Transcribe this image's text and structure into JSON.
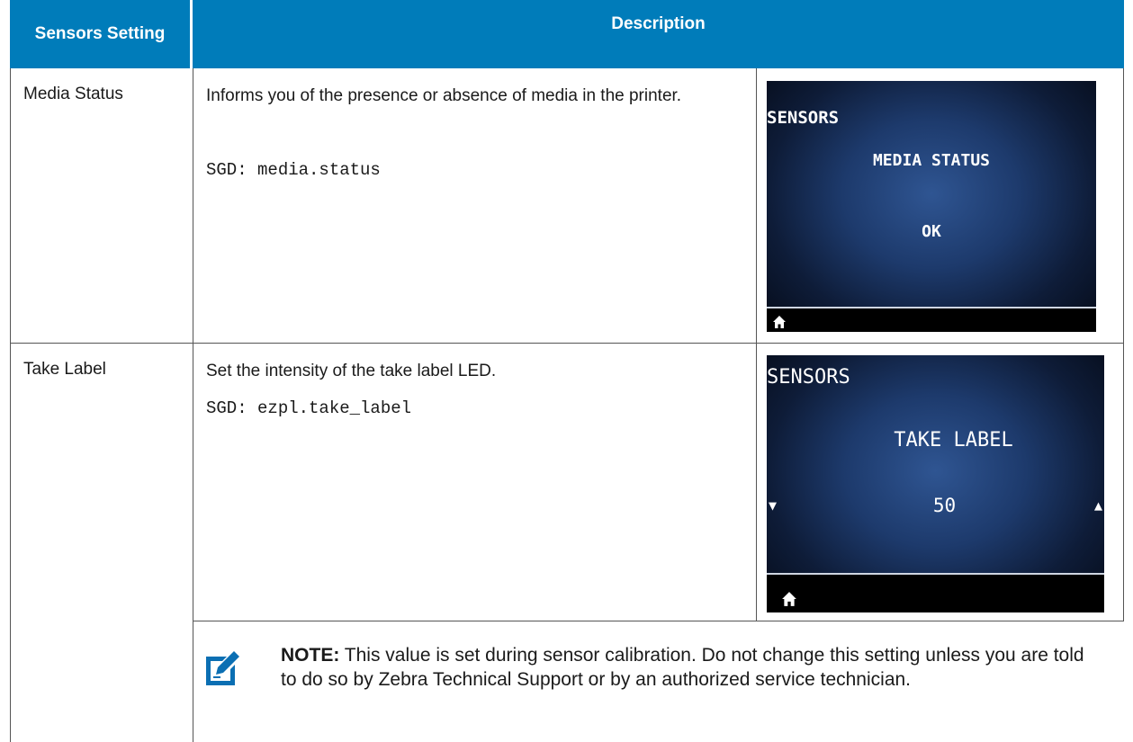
{
  "table": {
    "header": {
      "setting": "Sensors Setting",
      "description": "Description"
    },
    "rows": [
      {
        "setting": "Media Status",
        "description": "Informs you of the presence or absence of media in the printer.",
        "sgd": "SGD: media.status",
        "screen": {
          "title": "SENSORS",
          "item": "MEDIA STATUS",
          "value": "OK"
        }
      },
      {
        "setting": "Take Label",
        "description": "Set the intensity of the take label LED.",
        "sgd": "SGD: ezpl.take_label",
        "screen": {
          "title": "SENSORS",
          "item": "TAKE LABEL",
          "value": "50",
          "left_arrow": "▼",
          "right_arrow": "▲"
        }
      }
    ]
  },
  "note": {
    "label": "NOTE:",
    "text": " This value is set during sensor calibration. Do not change this setting unless you are told to do so by Zebra Technical Support or by an authorized service technician."
  },
  "colors": {
    "header_bg": "#007cba",
    "header_text": "#ffffff",
    "note_icon": "#0b6fb3"
  },
  "icons": [
    "home-icon",
    "note-pencil-icon"
  ]
}
